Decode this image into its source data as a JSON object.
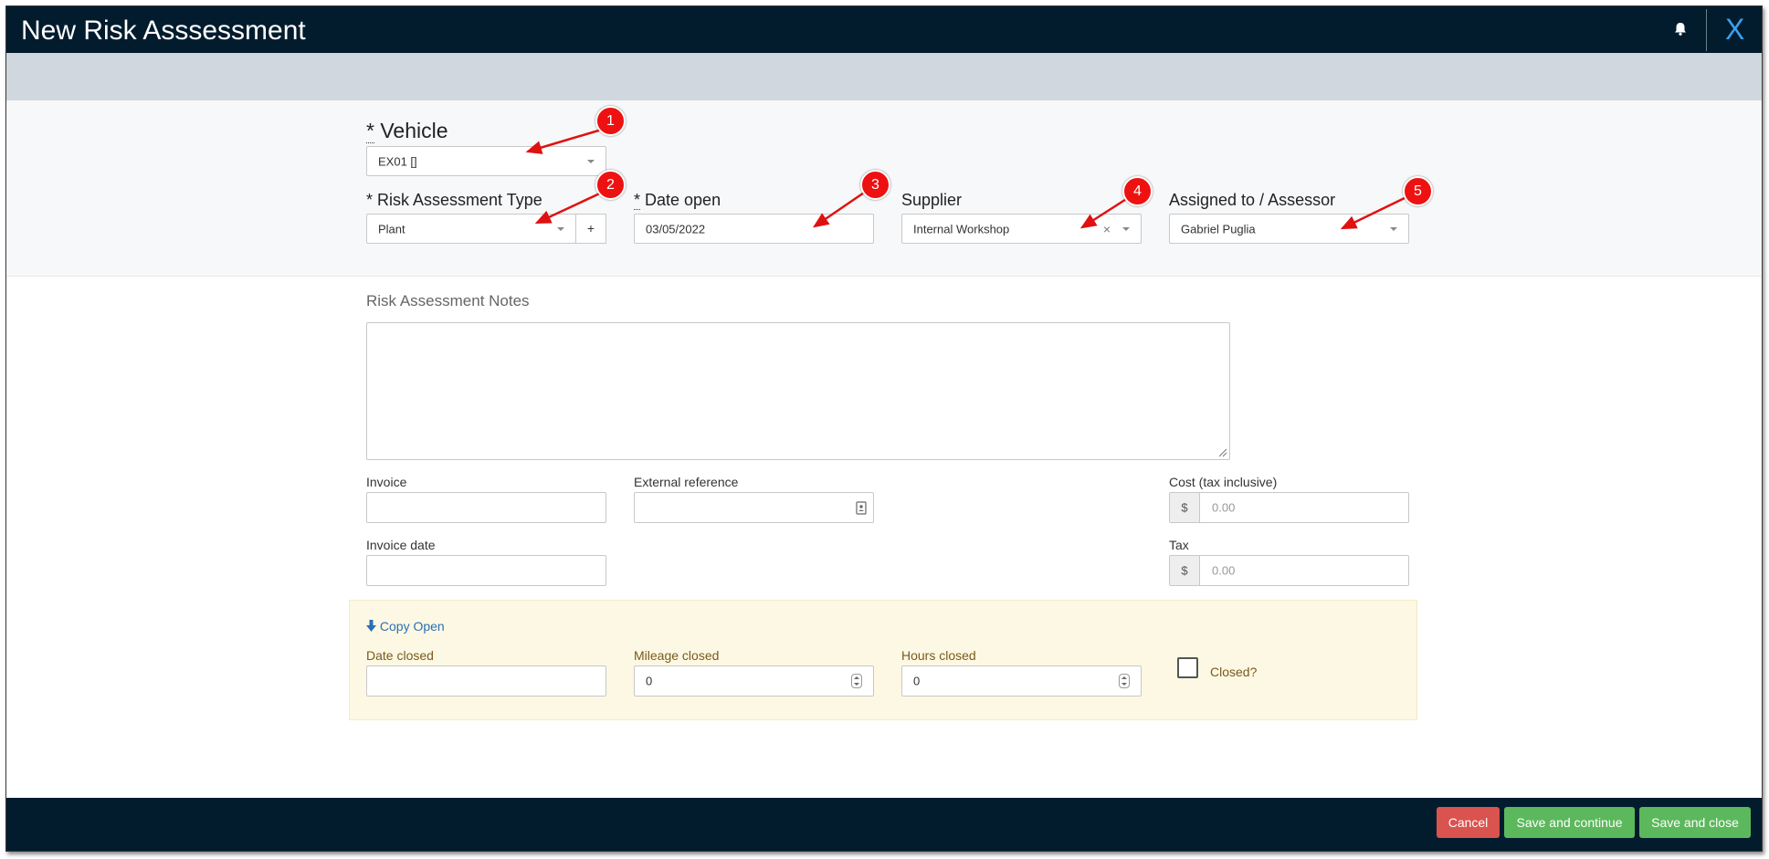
{
  "window": {
    "title": "New Risk Asssessment",
    "close_label": "X"
  },
  "form": {
    "vehicle": {
      "label_star": "*",
      "label": " Vehicle",
      "value": "EX01 []"
    },
    "risk_type": {
      "label": "* Risk Assessment Type",
      "value": "Plant",
      "add_label": "+"
    },
    "date_open": {
      "label_star": "*",
      "label": " Date open",
      "value": "03/05/2022"
    },
    "supplier": {
      "label": "Supplier",
      "value": "Internal Workshop",
      "clear_label": "×"
    },
    "assessor": {
      "label": "Assigned to / Assessor",
      "value": "Gabriel Puglia"
    },
    "notes": {
      "label": "Risk Assessment Notes",
      "value": ""
    },
    "invoice": {
      "label": "Invoice",
      "value": ""
    },
    "external_reference": {
      "label": "External reference",
      "value": ""
    },
    "cost": {
      "label": "Cost (tax inclusive)",
      "currency": "$",
      "placeholder": "0.00"
    },
    "invoice_date": {
      "label": "Invoice date",
      "value": ""
    },
    "tax": {
      "label": "Tax",
      "currency": "$",
      "placeholder": "0.00"
    }
  },
  "closing": {
    "copy_open": "Copy Open",
    "date_closed": {
      "label": "Date closed",
      "value": ""
    },
    "mileage_closed": {
      "label": "Mileage closed",
      "value": "0"
    },
    "hours_closed": {
      "label": "Hours closed",
      "value": "0"
    },
    "closed": {
      "label": "Closed?",
      "checked": false
    }
  },
  "footer": {
    "cancel": "Cancel",
    "save_continue": "Save and continue",
    "save_close": "Save and close"
  },
  "annotations": [
    "1",
    "2",
    "3",
    "4",
    "5"
  ],
  "colors": {
    "header_bg": "#021c2e",
    "accent_blue": "#3aa1ef",
    "cancel_red": "#d9534f",
    "save_green": "#5cb85c",
    "closed_panel": "#fcf8e3",
    "marker_red": "#ee1111"
  }
}
